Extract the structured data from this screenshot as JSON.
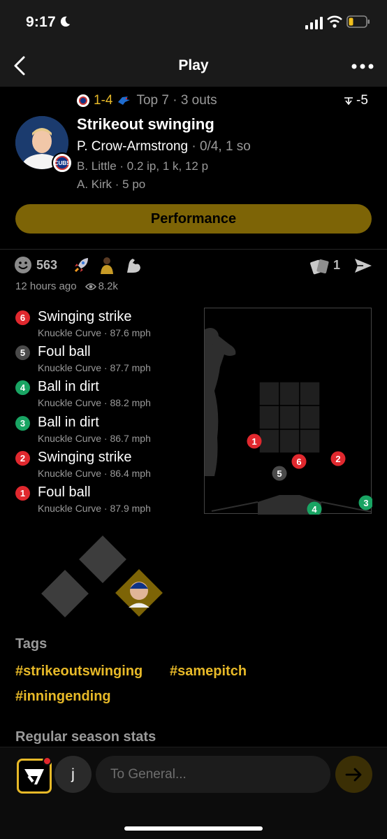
{
  "status_bar": {
    "time": "9:17"
  },
  "nav": {
    "title": "Play"
  },
  "game": {
    "score": "1-4",
    "inning_info": "Top 7 · 3 outs",
    "delta": "-5",
    "play_title": "Strikeout swinging",
    "batter_name": "P. Crow-Armstrong",
    "batter_stats": "· 0/4, 1 so",
    "pitcher_line": "B. Little · 0.2 ip, 1 k, 12 p",
    "catcher_line": "A. Kirk · 5 po",
    "team_badge": "CUBS"
  },
  "performance_button": "Performance",
  "reactions": {
    "count": "563",
    "cards_count": "1",
    "time_ago": "12 hours ago",
    "views": "8.2k"
  },
  "colors": {
    "accent": "#e7b928",
    "strike": "#e0282e",
    "ball": "#19a463",
    "foul": "#4a4a4a",
    "button": "#7d6406"
  },
  "pitches": [
    {
      "num": "6",
      "result": "Swinging strike",
      "detail": "Knuckle Curve ·  87.6 mph",
      "kind": "strike"
    },
    {
      "num": "5",
      "result": "Foul ball",
      "detail": "Knuckle Curve ·  87.7 mph",
      "kind": "foul"
    },
    {
      "num": "4",
      "result": "Ball in dirt",
      "detail": "Knuckle Curve ·  88.2 mph",
      "kind": "ball"
    },
    {
      "num": "3",
      "result": "Ball in dirt",
      "detail": "Knuckle Curve ·  86.7 mph",
      "kind": "ball"
    },
    {
      "num": "2",
      "result": "Swinging strike",
      "detail": "Knuckle Curve ·  86.4 mph",
      "kind": "strike"
    },
    {
      "num": "1",
      "result": "Foul ball",
      "detail": "Knuckle Curve ·  87.9 mph",
      "kind": "strike"
    }
  ],
  "tags": {
    "label": "Tags",
    "items": [
      "#strikeoutswinging",
      "#samepitch",
      "#inningending"
    ]
  },
  "season_stats_label": "Regular season stats",
  "composer": {
    "avatar_letter": "j",
    "placeholder": "To General..."
  }
}
